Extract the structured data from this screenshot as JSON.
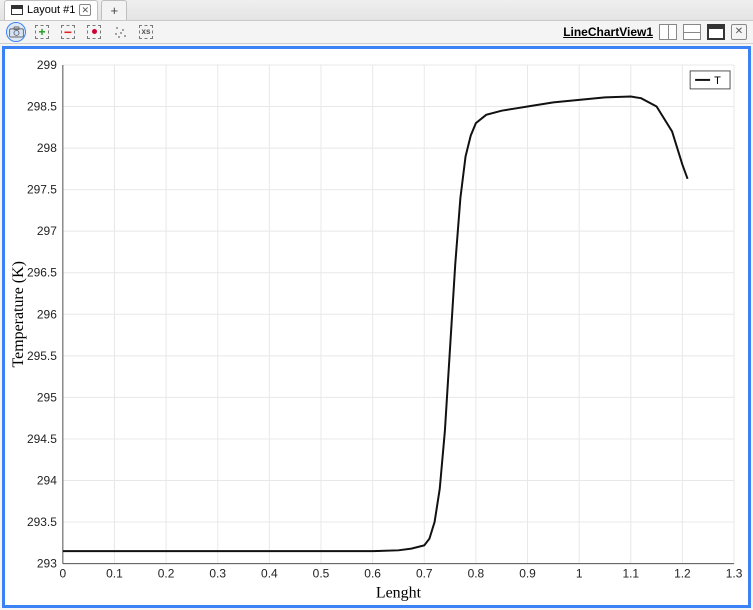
{
  "tabs": {
    "active_label": "Layout #1"
  },
  "toolbar": {
    "view_link": "LineChartView1"
  },
  "chart_data": {
    "type": "line",
    "title": "",
    "xlabel": "Lenght",
    "ylabel": "Temperature (K)",
    "xlim": [
      0,
      1.3
    ],
    "ylim": [
      293,
      299
    ],
    "xticks": [
      0,
      0.1,
      0.2,
      0.3,
      0.4,
      0.5,
      0.6,
      0.7,
      0.8,
      0.9,
      1,
      1.1,
      1.2,
      1.3
    ],
    "yticks": [
      293,
      293.5,
      294,
      294.5,
      295,
      295.5,
      296,
      296.5,
      297,
      297.5,
      298,
      298.5,
      299
    ],
    "series": [
      {
        "name": "T",
        "x": [
          0.0,
          0.05,
          0.1,
          0.15,
          0.2,
          0.25,
          0.3,
          0.35,
          0.4,
          0.45,
          0.5,
          0.55,
          0.6,
          0.65,
          0.675,
          0.7,
          0.71,
          0.72,
          0.73,
          0.74,
          0.75,
          0.76,
          0.77,
          0.78,
          0.79,
          0.8,
          0.82,
          0.85,
          0.88,
          0.9,
          0.95,
          1.0,
          1.05,
          1.1,
          1.12,
          1.15,
          1.18,
          1.2,
          1.21
        ],
        "y": [
          293.15,
          293.15,
          293.15,
          293.15,
          293.15,
          293.15,
          293.15,
          293.15,
          293.15,
          293.15,
          293.15,
          293.15,
          293.15,
          293.16,
          293.18,
          293.22,
          293.3,
          293.5,
          293.9,
          294.6,
          295.6,
          296.6,
          297.4,
          297.9,
          298.15,
          298.3,
          298.4,
          298.45,
          298.48,
          298.5,
          298.55,
          298.58,
          298.61,
          298.62,
          298.6,
          298.5,
          298.2,
          297.8,
          297.63
        ]
      }
    ],
    "legend": {
      "entries": [
        "T"
      ],
      "position": "top-right"
    }
  }
}
